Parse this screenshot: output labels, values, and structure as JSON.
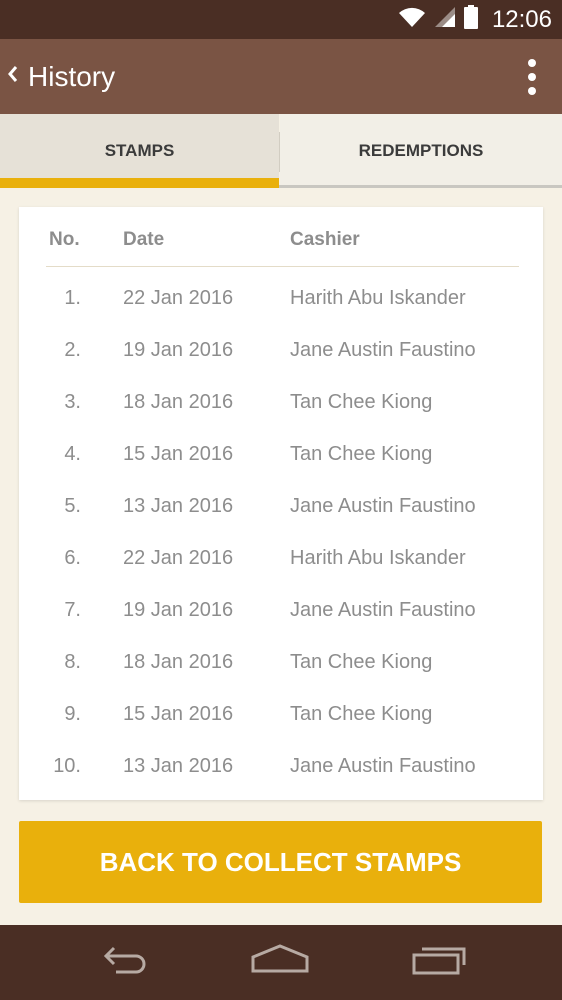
{
  "status_bar": {
    "time": "12:06",
    "icons": [
      "wifi-icon",
      "signal-icon",
      "battery-icon"
    ]
  },
  "app_bar": {
    "title": "History",
    "back_icon": "chevron-left-icon",
    "menu_icon": "more-vert-icon"
  },
  "tabs": [
    {
      "label": "STAMPS",
      "active": true
    },
    {
      "label": "REDEMPTIONS",
      "active": false
    }
  ],
  "table": {
    "headers": {
      "no": "No.",
      "date": "Date",
      "cashier": "Cashier"
    },
    "rows": [
      {
        "no": "1.",
        "date": "22 Jan 2016",
        "cashier": "Harith Abu Iskander"
      },
      {
        "no": "2.",
        "date": "19 Jan 2016",
        "cashier": "Jane Austin Faustino"
      },
      {
        "no": "3.",
        "date": "18 Jan 2016",
        "cashier": "Tan Chee Kiong"
      },
      {
        "no": "4.",
        "date": "15 Jan 2016",
        "cashier": "Tan Chee Kiong"
      },
      {
        "no": "5.",
        "date": "13 Jan 2016",
        "cashier": "Jane Austin Faustino"
      },
      {
        "no": "6.",
        "date": "22 Jan 2016",
        "cashier": "Harith Abu Iskander"
      },
      {
        "no": "7.",
        "date": "19 Jan 2016",
        "cashier": "Jane Austin Faustino"
      },
      {
        "no": "8.",
        "date": "18 Jan 2016",
        "cashier": "Tan Chee Kiong"
      },
      {
        "no": "9.",
        "date": "15 Jan 2016",
        "cashier": "Tan Chee Kiong"
      },
      {
        "no": "10.",
        "date": "13 Jan 2016",
        "cashier": "Jane Austin Faustino"
      }
    ]
  },
  "cta": {
    "label": "BACK TO COLLECT STAMPS"
  },
  "nav_bar": {
    "buttons": [
      "back-icon",
      "home-icon",
      "recents-icon"
    ]
  },
  "colors": {
    "status_bar": "#4a2e24",
    "app_bar": "#7a5444",
    "accent": "#e9b00c",
    "background": "#f6f1e5",
    "nav_bar": "#4a2e24"
  }
}
